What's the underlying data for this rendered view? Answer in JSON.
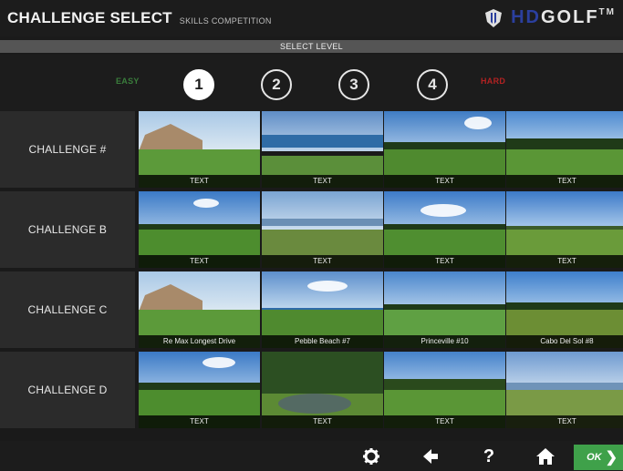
{
  "header": {
    "title": "CHALLENGE SELECT",
    "subtitle": "SKILLS COMPETITION",
    "logo": {
      "hd": "HD",
      "golf": "GOLF",
      "tm": "TM"
    }
  },
  "level_bar": {
    "label": "SELECT LEVEL"
  },
  "levels": {
    "easy_label": "EASY",
    "hard_label": "HARD",
    "buttons": [
      "1",
      "2",
      "3",
      "4"
    ],
    "selected": "1"
  },
  "rows": [
    {
      "label": "CHALLENGE #",
      "tiles": [
        "TEXT",
        "TEXT",
        "TEXT",
        "TEXT"
      ]
    },
    {
      "label": "CHALLENGE B",
      "tiles": [
        "TEXT",
        "TEXT",
        "TEXT",
        "TEXT"
      ]
    },
    {
      "label": "CHALLENGE C",
      "tiles": [
        "Re Max Longest Drive",
        "Pebble Beach #7",
        "Princeville #10",
        "Cabo Del Sol #8"
      ]
    },
    {
      "label": "CHALLENGE D",
      "tiles": [
        "TEXT",
        "TEXT",
        "TEXT",
        "TEXT"
      ]
    }
  ],
  "footer": {
    "icons": [
      "gear-icon",
      "back-arrow-icon",
      "help-icon",
      "home-icon"
    ],
    "ok_label": "OK"
  },
  "colors": {
    "easy": "#3a7d3c",
    "hard": "#b22222",
    "ok_button": "#3fa14a",
    "logo_hd": "#2b3f9e"
  }
}
